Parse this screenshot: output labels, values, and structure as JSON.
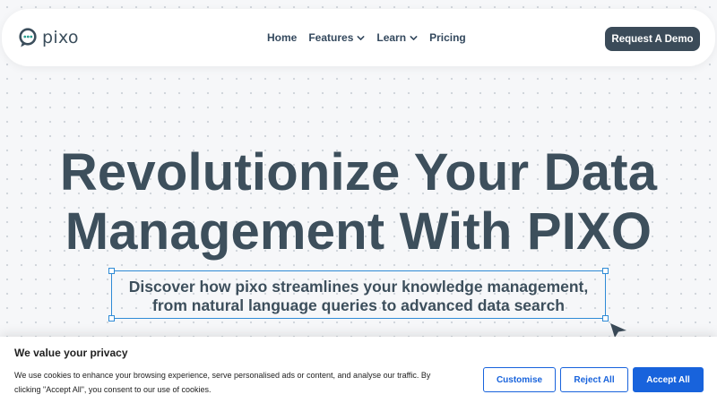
{
  "navbar": {
    "logo_text": "pixo",
    "links": [
      {
        "label": "Home",
        "has_dropdown": false
      },
      {
        "label": "Features",
        "has_dropdown": true
      },
      {
        "label": "Learn",
        "has_dropdown": true
      },
      {
        "label": "Pricing",
        "has_dropdown": false
      }
    ],
    "cta_label": "Request A Demo"
  },
  "hero": {
    "title_line1": "Revolutionize Your Data",
    "title_line2": "Management With PIXO",
    "subtitle_line1": "Discover how pixo streamlines your knowledge management,",
    "subtitle_line2": "from natural language queries to advanced data search"
  },
  "cookie_banner": {
    "title": "We value your privacy",
    "text_line1": "We use cookies to enhance your browsing experience, serve personalised ads or content, and analyse our traffic. By",
    "text_line2": "clicking \"Accept All\", you consent to our use of cookies.",
    "customise_label": "Customise",
    "reject_label": "Reject All",
    "accept_label": "Accept All"
  },
  "colors": {
    "brand_dark": "#3b4b59",
    "accent_teal": "#2a9d8f",
    "cookie_blue": "#1863dc",
    "selection_blue": "#2f8bd6"
  }
}
